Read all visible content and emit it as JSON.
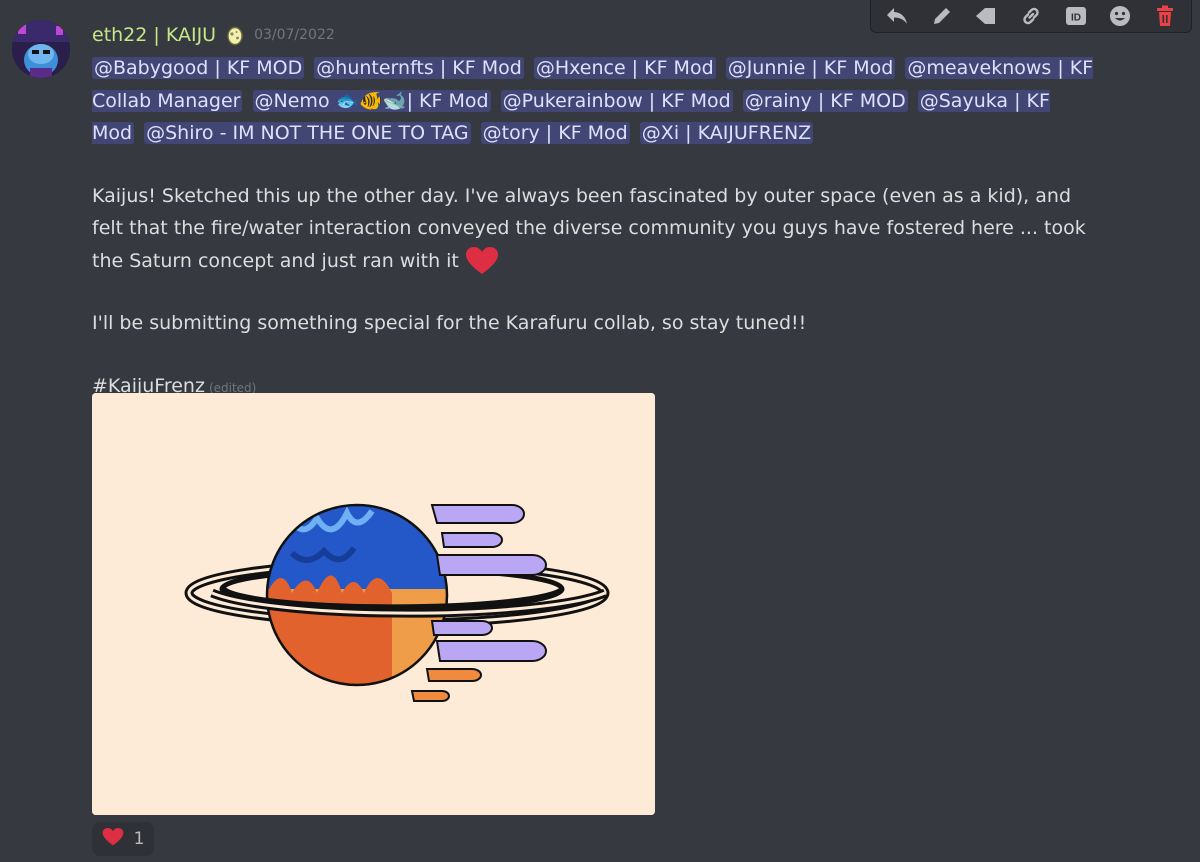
{
  "message": {
    "username": "eth22 | KAIJU",
    "timestamp": "03/07/2022",
    "mentions": [
      "@Babygood | KF MOD",
      "@hunternfts | KF Mod",
      "@Hxence | KF Mod",
      "@Junnie | KF Mod",
      "@meaveknows | KF Collab Manager",
      "@Nemo 🐟🐠🐋| KF Mod",
      "@Pukerainbow | KF Mod",
      "@rainy | KF MOD",
      "@Sayuka | KF Mod",
      "@Shiro - IM NOT THE ONE TO TAG",
      "@tory | KF Mod",
      "@Xi | KAIJUFRENZ"
    ],
    "paragraph1": "Kaijus! Sketched this up the other day. I've always been fascinated by outer space (even as a kid), and felt that the fire/water interaction conveyed the diverse community you guys have fostered here ... took the Saturn concept and just ran with it",
    "paragraph2": "I'll be submitting something special for the Karafuru collab, so stay tuned!!",
    "hashtag": "#KaijuFrenz",
    "edited_label": "(edited)"
  },
  "reaction": {
    "emoji": "heart-icon",
    "count": "1"
  },
  "toolbar": {
    "icons": [
      "reply-icon",
      "edit-icon",
      "tag-icon",
      "link-icon",
      "id-icon",
      "emoji-icon",
      "delete-icon"
    ]
  },
  "colors": {
    "background": "#36393f",
    "username": "#c6e889",
    "mention_bg": "#414675",
    "mention_text": "#dee0fc",
    "delete": "#ed4245",
    "heart": "#dd2e44"
  }
}
